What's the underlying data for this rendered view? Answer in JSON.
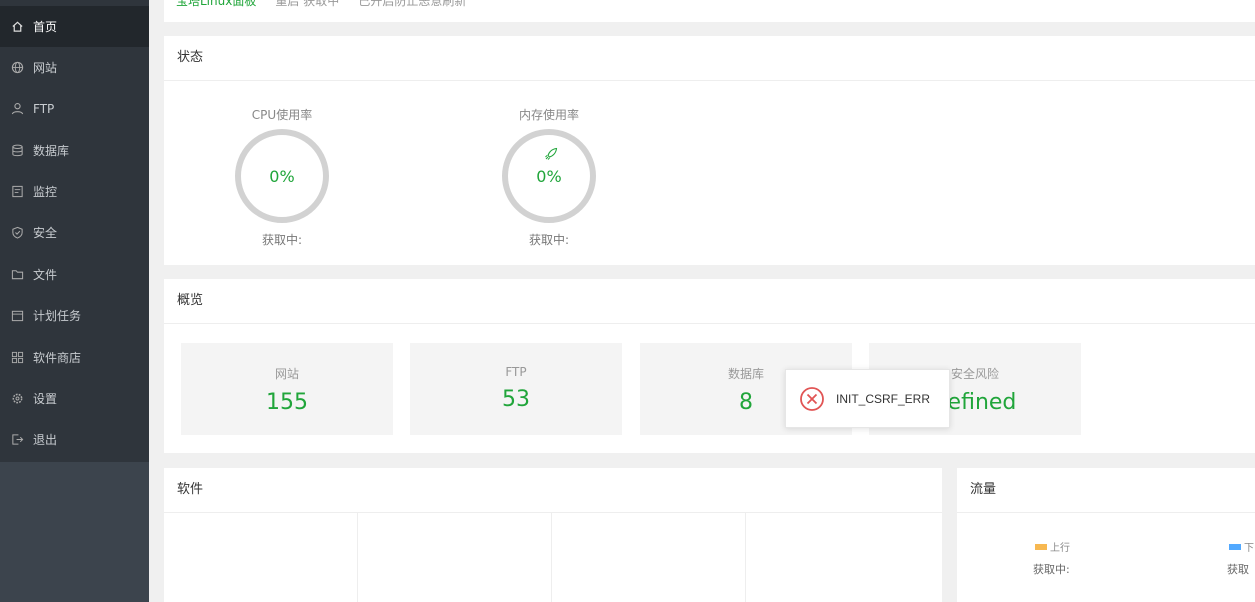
{
  "breadcrumb": {
    "link": "宝塔Linux面板",
    "text1": "重启 获取中",
    "text2": "已开启防止恶意刷新"
  },
  "sidebar": {
    "items": [
      {
        "label": "首页",
        "icon": "home-icon"
      },
      {
        "label": "网站",
        "icon": "globe-icon"
      },
      {
        "label": "FTP",
        "icon": "user-icon"
      },
      {
        "label": "数据库",
        "icon": "database-icon"
      },
      {
        "label": "监控",
        "icon": "monitor-icon"
      },
      {
        "label": "安全",
        "icon": "shield-icon"
      },
      {
        "label": "文件",
        "icon": "folder-icon"
      },
      {
        "label": "计划任务",
        "icon": "calendar-icon"
      },
      {
        "label": "软件商店",
        "icon": "grid-icon"
      },
      {
        "label": "设置",
        "icon": "gear-icon"
      },
      {
        "label": "退出",
        "icon": "logout-icon"
      }
    ]
  },
  "status": {
    "title": "状态",
    "cpu": {
      "label": "CPU使用率",
      "value": "0%",
      "footer": "获取中:"
    },
    "mem": {
      "label": "内存使用率",
      "value": "0%",
      "footer": "获取中:"
    }
  },
  "overview": {
    "title": "概览",
    "items": [
      {
        "label": "网站",
        "value": "155"
      },
      {
        "label": "FTP",
        "value": "53"
      },
      {
        "label": "数据库",
        "value": "8"
      },
      {
        "label": "安全风险",
        "value": "defined"
      }
    ]
  },
  "toast": {
    "message": "INIT_CSRF_ERR",
    "icon": "error-circle-icon"
  },
  "software": {
    "title": "软件"
  },
  "traffic": {
    "title": "流量",
    "up_label": "上行",
    "up_value": "获取中:",
    "down_label": "下",
    "down_value": "获取"
  },
  "colors": {
    "accent": "#20a53a",
    "sidebar": "#2f353c",
    "up": "#f7b851",
    "down": "#52a9ff",
    "error": "#e15454"
  }
}
